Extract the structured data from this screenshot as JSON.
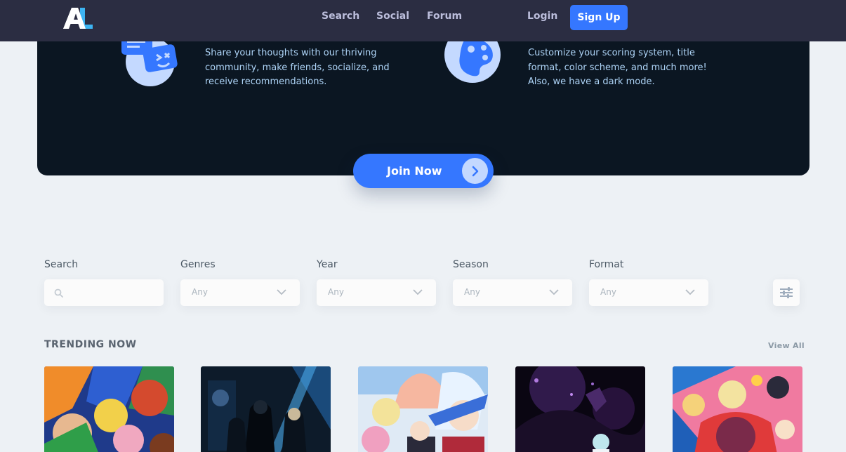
{
  "header": {
    "logo_text": "AL",
    "nav": [
      {
        "label": "Search"
      },
      {
        "label": "Social"
      },
      {
        "label": "Forum"
      }
    ],
    "login_label": "Login",
    "signup_label": "Sign Up"
  },
  "hero": {
    "features": [
      {
        "icon": "chat-bubbles-icon",
        "text": "Share your thoughts with our thriving community, make friends, socialize, and receive recommendations."
      },
      {
        "icon": "palette-icon",
        "text": "Customize your scoring system, title format, color scheme, and much more! Also, we have a dark mode."
      }
    ],
    "join_label": "Join Now"
  },
  "filters": {
    "search": {
      "label": "Search",
      "placeholder": ""
    },
    "genres": {
      "label": "Genres",
      "value": "Any"
    },
    "year": {
      "label": "Year",
      "value": "Any"
    },
    "season": {
      "label": "Season",
      "value": "Any"
    },
    "format": {
      "label": "Format",
      "value": "Any"
    }
  },
  "trending": {
    "title": "TRENDING NOW",
    "view_all": "View All",
    "cards": [
      {
        "name": "anime-cover-1"
      },
      {
        "name": "anime-cover-2"
      },
      {
        "name": "anime-cover-3"
      },
      {
        "name": "anime-cover-4"
      },
      {
        "name": "anime-cover-5"
      }
    ]
  },
  "colors": {
    "header_bg": "#2b2d42",
    "hero_bg": "#0b1622",
    "accent": "#3577ff",
    "page_bg": "#edf1f5"
  }
}
